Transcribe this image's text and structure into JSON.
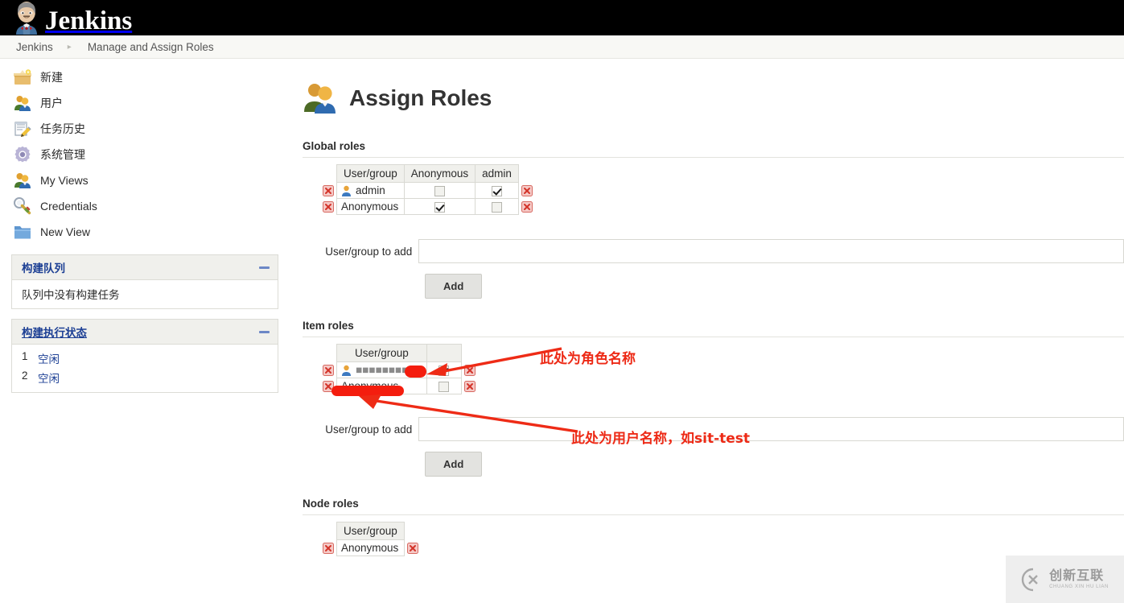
{
  "header": {
    "brand": "Jenkins",
    "logo_icon": "jenkins-butler-icon"
  },
  "breadcrumb": {
    "items": [
      "Jenkins",
      "Manage and Assign Roles"
    ],
    "separator": "▸"
  },
  "sidebar": {
    "items": [
      {
        "label": "新建",
        "icon": "new-item-box-icon"
      },
      {
        "label": "用户",
        "icon": "users-icon"
      },
      {
        "label": "任务历史",
        "icon": "build-history-icon"
      },
      {
        "label": "系统管理",
        "icon": "gear-icon"
      },
      {
        "label": "My Views",
        "icon": "my-views-icon"
      },
      {
        "label": "Credentials",
        "icon": "credentials-key-icon"
      },
      {
        "label": "New View",
        "icon": "folder-icon"
      }
    ],
    "build_queue": {
      "title": "构建队列",
      "empty_text": "队列中没有构建任务",
      "collapse_icon": "collapse-minus-icon"
    },
    "build_executor_status": {
      "title": "构建执行状态",
      "collapse_icon": "collapse-minus-icon",
      "executors": [
        {
          "num": "1",
          "status": "空闲"
        },
        {
          "num": "2",
          "status": "空闲"
        }
      ]
    }
  },
  "main": {
    "title": "Assign Roles",
    "title_icon": "assign-roles-people-icon",
    "global_roles": {
      "heading": "Global roles",
      "columns": [
        "User/group",
        "Anonymous",
        "admin"
      ],
      "rows": [
        {
          "user": "admin",
          "user_icon": "person-icon",
          "checks": [
            false,
            true
          ]
        },
        {
          "user": "Anonymous",
          "user_icon": "",
          "checks": [
            true,
            false
          ]
        }
      ],
      "add_label": "User/group to add",
      "add_value": "",
      "add_placeholder": "",
      "add_button": "Add"
    },
    "item_roles": {
      "heading": "Item roles",
      "columns": [
        "User/group",
        "■■■"
      ],
      "rows": [
        {
          "user": "■■■■■■■■■",
          "user_icon": "person-icon",
          "checks": [
            true
          ]
        },
        {
          "user": "Anonymous",
          "user_icon": "",
          "checks": [
            false
          ]
        }
      ],
      "add_label": "User/group to add",
      "add_value": "",
      "add_placeholder": "",
      "add_button": "Add"
    },
    "node_roles": {
      "heading": "Node roles",
      "columns": [
        "User/group"
      ],
      "rows": [
        {
          "user": "Anonymous",
          "user_icon": "",
          "checks": []
        }
      ]
    }
  },
  "annotations": {
    "color": "#ed2a16",
    "role_name_note": "此处为角色名称",
    "user_name_note": "此处为用户名称，如sit-test"
  },
  "watermark": {
    "cn": "创新互联",
    "en": "CHUANG XIN HU LIAN",
    "icon": "cx-logo-icon"
  },
  "icons": {
    "delete_icon": "delete-red-x-icon",
    "checkbox_checked": "checkbox-checked-icon",
    "checkbox_unchecked": "checkbox-unchecked-icon"
  }
}
